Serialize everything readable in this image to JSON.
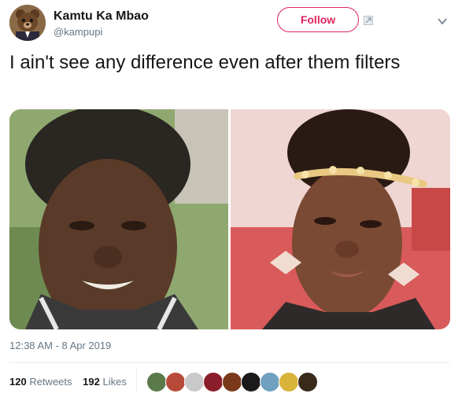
{
  "author": {
    "name": "Kamtu Ka Mbao",
    "handle": "@kampupi",
    "avatar_icon": "teddy-bear-avatar"
  },
  "follow_label": "Follow",
  "tweet_text": "I ain't see any difference even after them filters",
  "photos": [
    {
      "icon": "woman-portrait-photo"
    },
    {
      "icon": "woman-filtered-portrait-photo"
    }
  ],
  "timestamp": "12:38 AM - 8 Apr 2019",
  "stats": {
    "retweets_count": "120",
    "retweets_label": "Retweets",
    "likes_count": "192",
    "likes_label": "Likes"
  },
  "likers": [
    "#5a7a4a",
    "#b84a3a",
    "#c9c9c9",
    "#8a1e2a",
    "#7a3a1a",
    "#1a1a1a",
    "#6fa0c0",
    "#d9b43a",
    "#3a2a1a"
  ],
  "colors": {
    "follow": "#e0245e",
    "muted": "#657786"
  }
}
